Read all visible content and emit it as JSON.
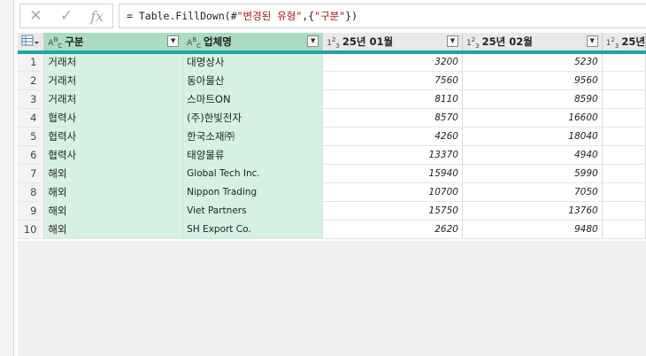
{
  "formula_bar": {
    "cancel_icon": "✕",
    "commit_icon": "✓",
    "fx_label": "fx",
    "prefix": "= Table.FillDown(#",
    "string1": "\"변경된 유형\"",
    "middle": ",{",
    "string2": "\"구분\"",
    "suffix": "})"
  },
  "table": {
    "columns": [
      {
        "type_icon": "ABC",
        "label": "구분"
      },
      {
        "type_icon": "ABC",
        "label": "업체명"
      },
      {
        "type_icon": "123",
        "label": "25년 01월"
      },
      {
        "type_icon": "123",
        "label": "25년 02월"
      },
      {
        "type_icon": "123",
        "label": "25년"
      }
    ],
    "rows": [
      {
        "n": "1",
        "c1": "거래처",
        "c2": "대명상사",
        "v1": "3200",
        "v2": "5230"
      },
      {
        "n": "2",
        "c1": "거래처",
        "c2": "동아물산",
        "v1": "7560",
        "v2": "9560"
      },
      {
        "n": "3",
        "c1": "거래처",
        "c2": "스마트ON",
        "v1": "8110",
        "v2": "8590"
      },
      {
        "n": "4",
        "c1": "협력사",
        "c2": "(주)한빛전자",
        "v1": "8570",
        "v2": "16600"
      },
      {
        "n": "5",
        "c1": "협력사",
        "c2": "한국소재㈜",
        "v1": "4260",
        "v2": "18040"
      },
      {
        "n": "6",
        "c1": "협력사",
        "c2": "태양물류",
        "v1": "13370",
        "v2": "4940"
      },
      {
        "n": "7",
        "c1": "해외",
        "c2": "Global Tech Inc.",
        "v1": "15940",
        "v2": "5990"
      },
      {
        "n": "8",
        "c1": "해외",
        "c2": "Nippon Trading",
        "v1": "10700",
        "v2": "7050"
      },
      {
        "n": "9",
        "c1": "해외",
        "c2": "Viet Partners",
        "v1": "15750",
        "v2": "13760"
      },
      {
        "n": "10",
        "c1": "해외",
        "c2": "SH Export Co.",
        "v1": "2620",
        "v2": "9480"
      }
    ]
  },
  "colors": {
    "selected_column": "#a9dcc0",
    "selected_cells": "#d6f0e1",
    "header_underline": "#21a4a1"
  }
}
